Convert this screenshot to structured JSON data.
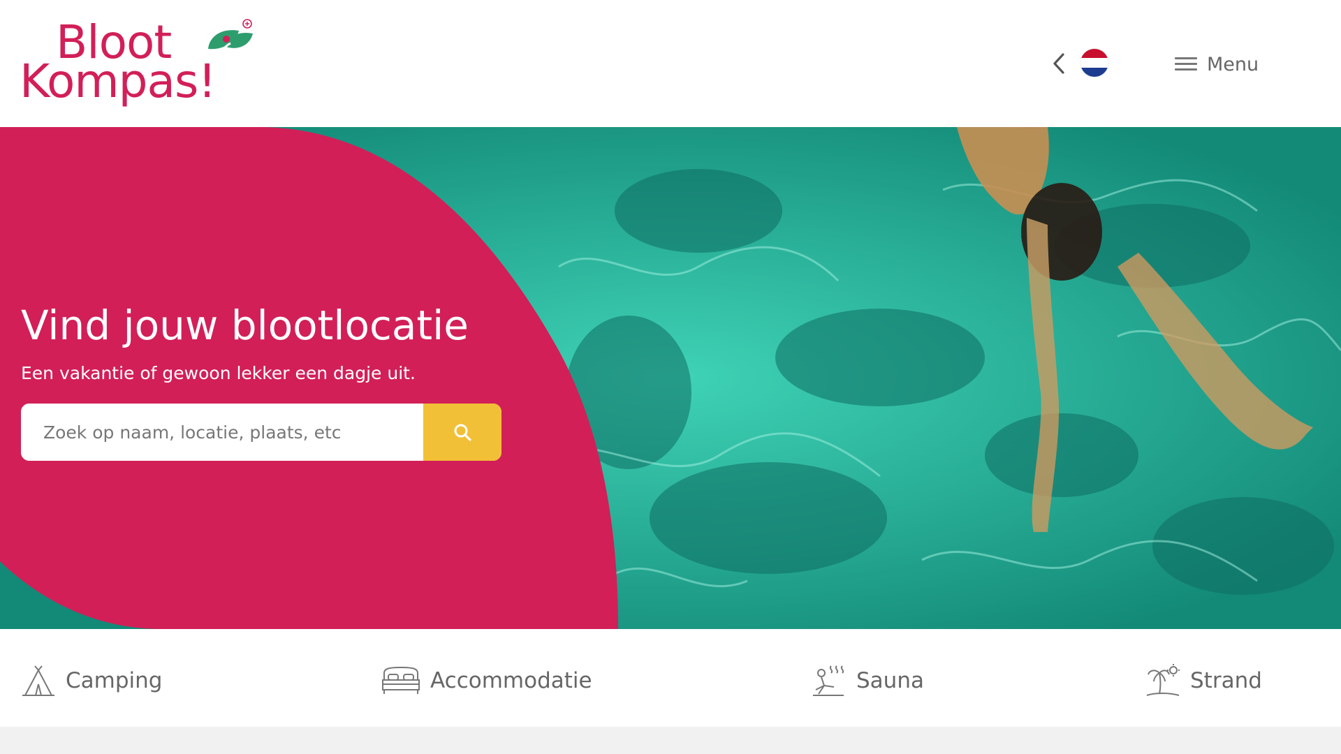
{
  "brand": {
    "line1": "Bloot",
    "line2": "Kompas!",
    "color": "#d21f58",
    "leaf_color": "#2e9d6e"
  },
  "header": {
    "back_icon": "chevron-left-icon",
    "language_flag": "flag-nl-icon",
    "menu_icon": "hamburger-icon",
    "menu_label": "Menu"
  },
  "hero": {
    "title": "Vind jouw blootlocatie",
    "subtitle": "Een vakantie of gewoon lekker een dagje uit.",
    "panel_color": "#d21f58",
    "search": {
      "placeholder": "Zoek op naam, locatie, plaats, etc",
      "value": "",
      "button_icon": "search-icon",
      "button_color": "#f2c037"
    }
  },
  "categories": [
    {
      "label": "Camping",
      "icon": "tent-icon"
    },
    {
      "label": "Accommodatie",
      "icon": "bed-icon"
    },
    {
      "label": "Sauna",
      "icon": "sauna-icon"
    },
    {
      "label": "Strand",
      "icon": "palm-beach-icon"
    }
  ]
}
